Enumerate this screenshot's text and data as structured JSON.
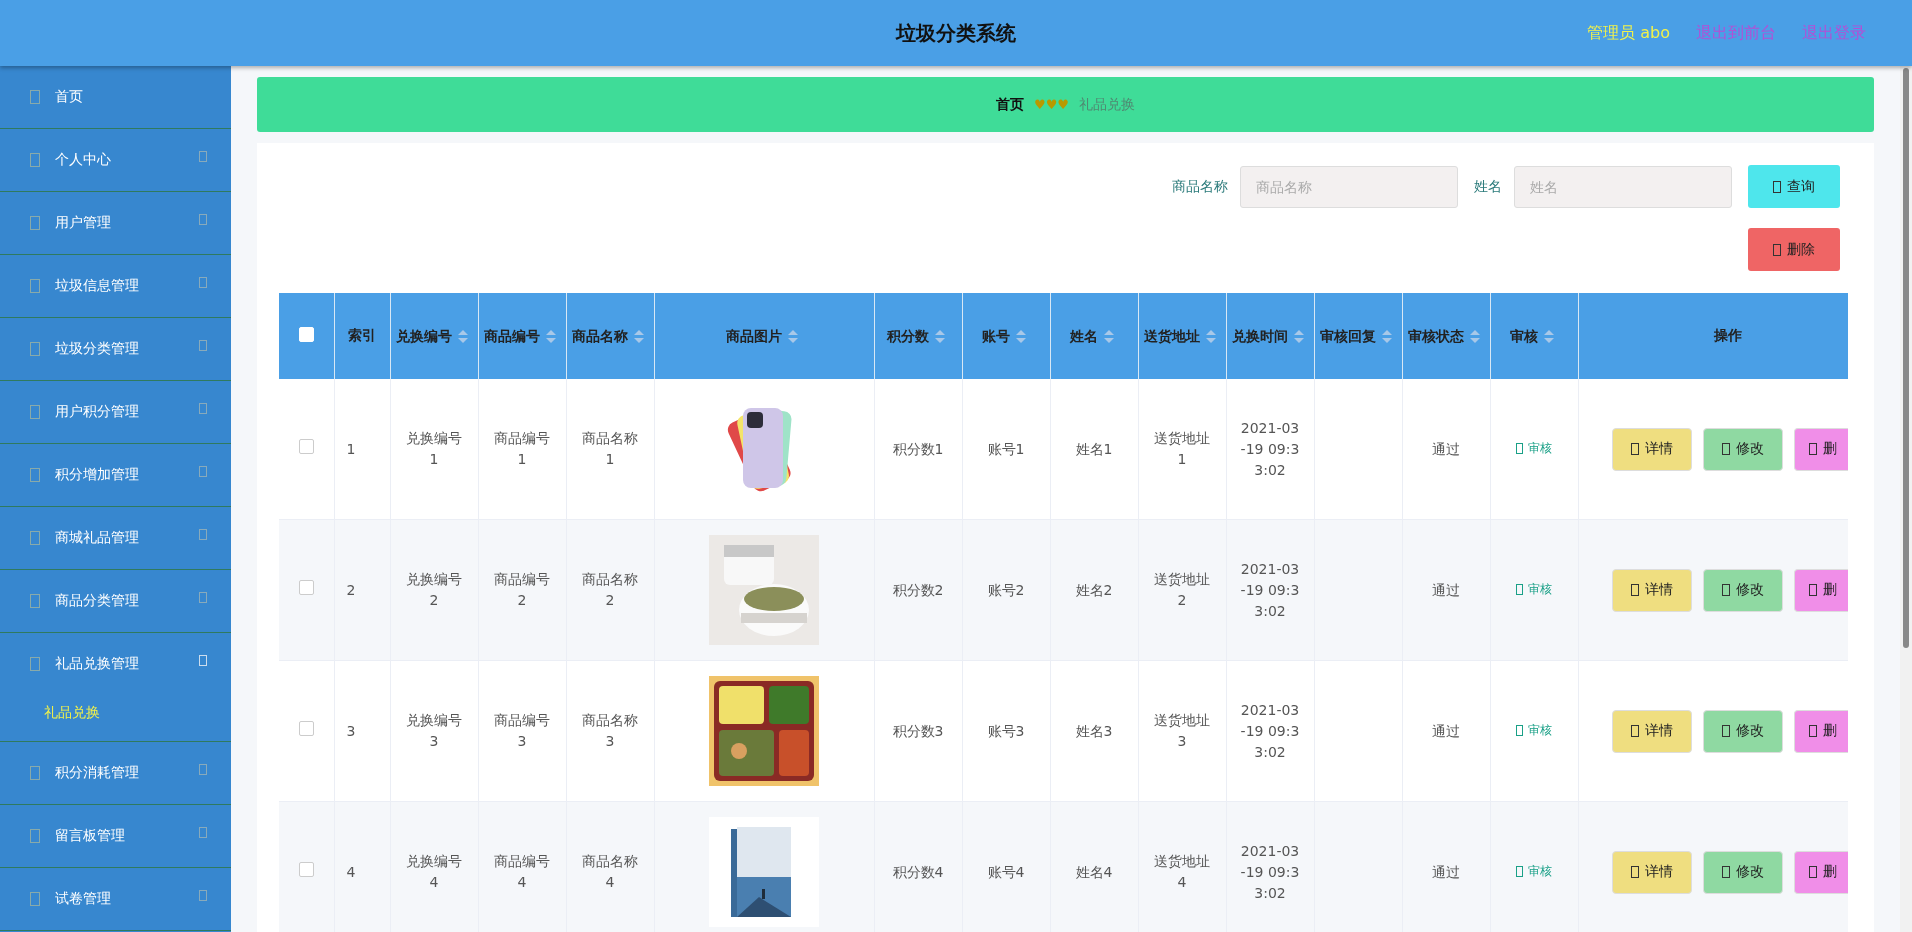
{
  "header": {
    "title": "垃圾分类系统",
    "user": "管理员 abo",
    "links": [
      "退出到前台",
      "退出登录"
    ]
  },
  "sidebar": {
    "items": [
      {
        "label": "首页",
        "kind": "link",
        "selected": false
      },
      {
        "label": "个人中心",
        "kind": "menu",
        "expanded": false,
        "selected": false
      },
      {
        "label": "用户管理",
        "kind": "menu",
        "expanded": false,
        "selected": false
      },
      {
        "label": "垃圾信息管理",
        "kind": "menu",
        "expanded": false,
        "selected": false
      },
      {
        "label": "垃圾分类管理",
        "kind": "menu",
        "expanded": false,
        "selected": false
      },
      {
        "label": "用户积分管理",
        "kind": "menu",
        "expanded": false,
        "selected": false
      },
      {
        "label": "积分增加管理",
        "kind": "menu",
        "expanded": false,
        "selected": false
      },
      {
        "label": "商城礼品管理",
        "kind": "menu",
        "expanded": false,
        "selected": false
      },
      {
        "label": "商品分类管理",
        "kind": "menu",
        "expanded": false,
        "selected": false
      },
      {
        "label": "礼品兑换管理",
        "kind": "menu",
        "expanded": true,
        "selected": false,
        "children": [
          {
            "label": "礼品兑换",
            "selected": true
          }
        ]
      },
      {
        "label": "积分消耗管理",
        "kind": "menu",
        "expanded": false,
        "selected": false
      },
      {
        "label": "留言板管理",
        "kind": "menu",
        "expanded": false,
        "selected": false
      },
      {
        "label": "试卷管理",
        "kind": "menu",
        "expanded": false,
        "selected": false
      }
    ]
  },
  "breadcrumb": {
    "items": [
      "首页",
      "礼品兑换"
    ],
    "separator": "♥♥♥"
  },
  "search": {
    "fields": [
      {
        "label": "商品名称",
        "placeholder": "商品名称"
      },
      {
        "label": "姓名",
        "placeholder": "姓名"
      }
    ],
    "query_button": "查询",
    "delete_button": "删除"
  },
  "table": {
    "columns": [
      {
        "label": "索引",
        "sortable": false
      },
      {
        "label": "兑换编号",
        "sortable": true
      },
      {
        "label": "商品编号",
        "sortable": true
      },
      {
        "label": "商品名称",
        "sortable": true
      },
      {
        "label": "商品图片",
        "sortable": true
      },
      {
        "label": "积分数",
        "sortable": true
      },
      {
        "label": "账号",
        "sortable": true
      },
      {
        "label": "姓名",
        "sortable": true
      },
      {
        "label": "送货地址",
        "sortable": true
      },
      {
        "label": "兑换时间",
        "sortable": true
      },
      {
        "label": "审核回复",
        "sortable": true
      },
      {
        "label": "审核状态",
        "sortable": true
      },
      {
        "label": "审核",
        "sortable": true
      },
      {
        "label": "操作",
        "sortable": false
      }
    ],
    "select_all": {
      "checked": false
    },
    "rows": [
      {
        "checked": false,
        "index": "1",
        "exchange_no": "兑换编号1",
        "product_no": "商品编号1",
        "product_name": "商品名称1",
        "picture": {
          "kind": "phones"
        },
        "points": "积分数1",
        "account": "账号1",
        "name": "姓名1",
        "address": "送货地址1",
        "time": "2021-03-19 09:33:02",
        "status": "通过",
        "audit": "审核",
        "actions": [
          "详情",
          "修改",
          "删"
        ]
      },
      {
        "checked": false,
        "index": "2",
        "exchange_no": "兑换编号2",
        "product_no": "商品编号2",
        "product_name": "商品名称2",
        "picture": {
          "kind": "jars"
        },
        "points": "积分数2",
        "account": "账号2",
        "name": "姓名2",
        "address": "送货地址2",
        "time": "2021-03-19 09:33:02",
        "status": "通过",
        "audit": "审核",
        "actions": [
          "详情",
          "修改",
          "删"
        ]
      },
      {
        "checked": false,
        "index": "3",
        "exchange_no": "兑换编号3",
        "product_no": "商品编号3",
        "product_name": "商品名称3",
        "picture": {
          "kind": "food"
        },
        "points": "积分数3",
        "account": "账号3",
        "name": "姓名3",
        "address": "送货地址3",
        "time": "2021-03-19 09:33:02",
        "status": "通过",
        "audit": "审核",
        "actions": [
          "详情",
          "修改",
          "删"
        ]
      },
      {
        "checked": false,
        "index": "4",
        "exchange_no": "兑换编号4",
        "product_no": "商品编号4",
        "product_name": "商品名称4",
        "picture": {
          "kind": "book"
        },
        "points": "积分数4",
        "account": "账号4",
        "name": "姓名4",
        "address": "送货地址4",
        "time": "2021-03-19 09:33:02",
        "status": "通过",
        "audit": "审核",
        "actions": [
          "详情",
          "修改",
          "删"
        ]
      }
    ]
  }
}
